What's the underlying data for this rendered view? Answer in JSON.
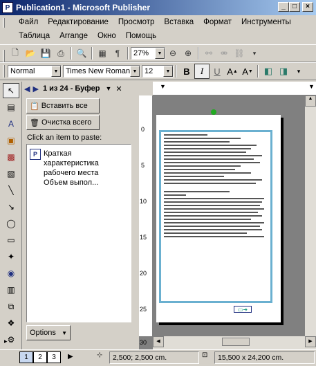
{
  "window": {
    "title": "Publication1 - Microsoft Publisher",
    "controls": [
      "_",
      "□",
      "×"
    ]
  },
  "menu": {
    "row1": [
      "Файл",
      "Редактирование",
      "Просмотр",
      "Вставка",
      "Формат",
      "Инструменты"
    ],
    "row2": [
      "Таблица",
      "Arrange",
      "Окно",
      "Помощь"
    ]
  },
  "toolbar": {
    "zoom": "27%"
  },
  "format_toolbar": {
    "style": "Normal",
    "font": "Times New Roman",
    "size": "12",
    "bold": "B",
    "italic": "I",
    "underline": "U"
  },
  "taskpane": {
    "title": "1 из 24 - Буфер",
    "paste_all": "Вставить все",
    "clear_all": "Очистка всего",
    "hint": "Click an item to paste:",
    "clip_item": [
      "Краткая",
      "характеристика",
      "рабочего места",
      "Объем выпол..."
    ],
    "options": "Options"
  },
  "ruler": {
    "vertical_ticks": [
      "0",
      "5",
      "10",
      "15",
      "20",
      "25",
      "30"
    ]
  },
  "status": {
    "pages": [
      "1",
      "2",
      "3"
    ],
    "position": "2,500; 2,500 cm.",
    "size": "15,500 x 24,200 cm."
  }
}
